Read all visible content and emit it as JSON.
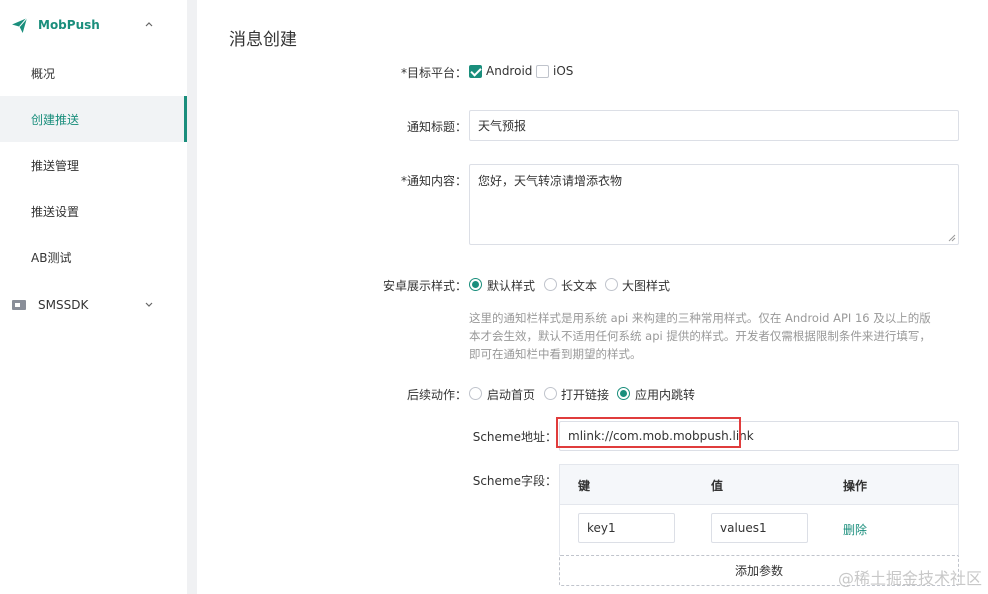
{
  "sidebar": {
    "brand": "MobPush",
    "items": [
      {
        "label": "概况"
      },
      {
        "label": "创建推送"
      },
      {
        "label": "推送管理"
      },
      {
        "label": "推送设置"
      },
      {
        "label": "AB测试"
      }
    ],
    "group2": "SMSSDK"
  },
  "page": {
    "title": "消息创建"
  },
  "form": {
    "platform_label": "*目标平台：",
    "platform_options": [
      {
        "label": "Android",
        "checked": true
      },
      {
        "label": "iOS",
        "checked": false
      }
    ],
    "title_label": "通知标题：",
    "title_value": "天气预报",
    "content_label": "*通知内容：",
    "content_value": "您好，天气转凉请增添衣物",
    "style_label": "安卓展示样式：",
    "style_options": [
      {
        "label": "默认样式",
        "selected": true
      },
      {
        "label": "长文本",
        "selected": false
      },
      {
        "label": "大图样式",
        "selected": false
      }
    ],
    "style_hint_1": "这里的通知栏样式是用系统 api 来构建的三种常用样式。仅在 Android API 16 及以上的版",
    "style_hint_2": "本才会生效，默认不适用任何系统 api 提供的样式。开发者仅需根据限制条件来进行填写，",
    "style_hint_3": "即可在通知栏中看到期望的样式。",
    "action_label": "后续动作：",
    "action_options": [
      {
        "label": "启动首页",
        "selected": false
      },
      {
        "label": "打开链接",
        "selected": false
      },
      {
        "label": "应用内跳转",
        "selected": true
      }
    ],
    "scheme_label": "Scheme地址：",
    "scheme_value": "mlink://com.mob.mobpush.link",
    "fields_label": "Scheme字段：",
    "table": {
      "headers": [
        "键",
        "值",
        "操作"
      ],
      "rows": [
        {
          "key": "key1",
          "value": "values1",
          "action": "删除"
        }
      ],
      "add_label": "添加参数"
    }
  },
  "watermark": "@稀土掘金技术社区",
  "colors": {
    "accent": "#1a8e7c",
    "highlight": "#e03c3c"
  }
}
